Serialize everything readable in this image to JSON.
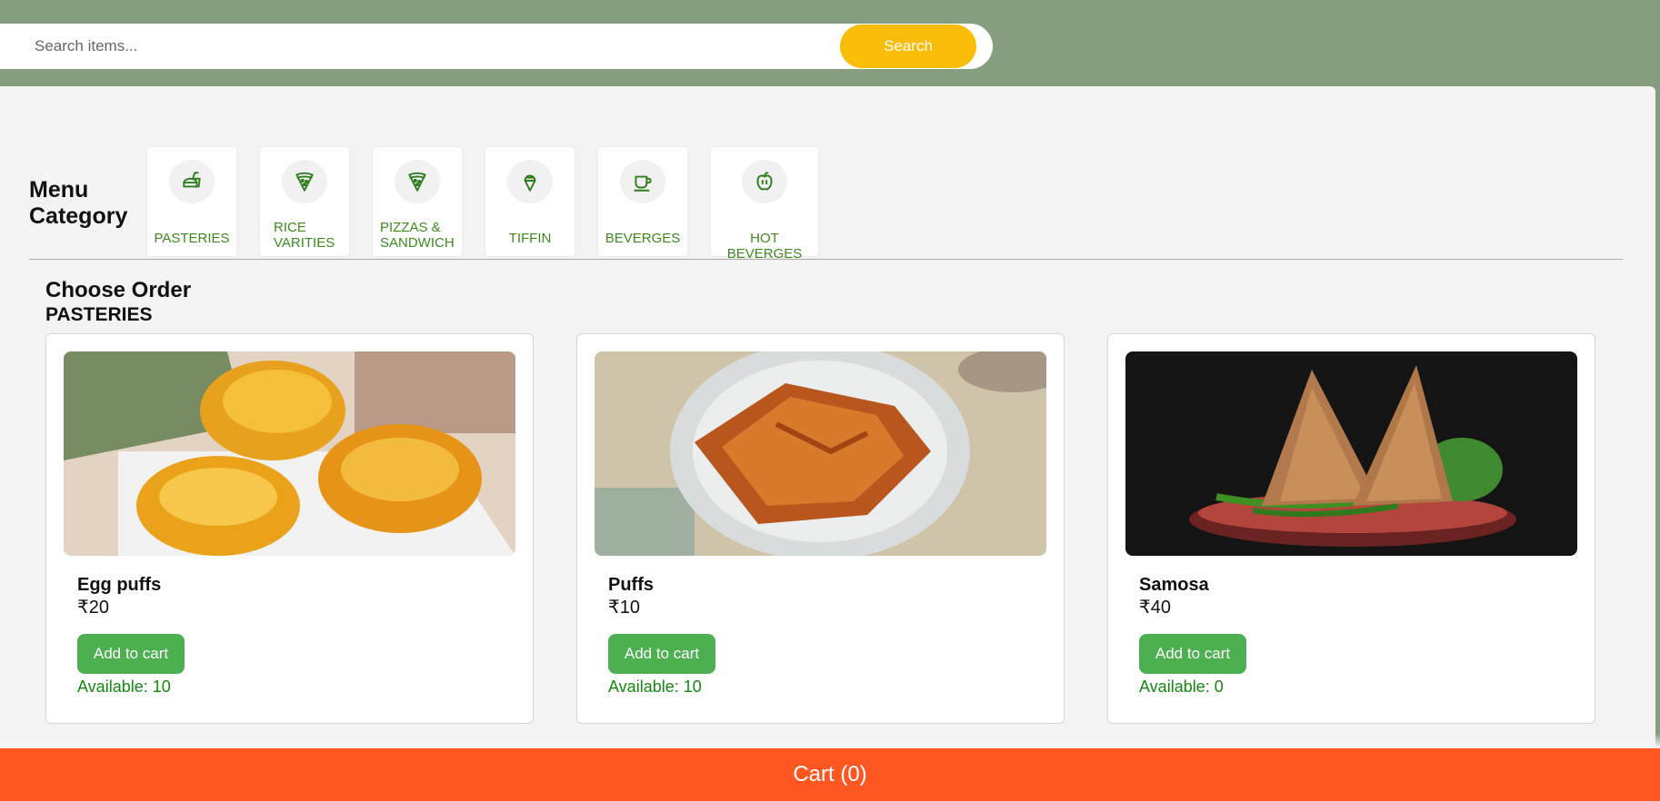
{
  "search": {
    "placeholder": "Search items...",
    "button_label": "Search"
  },
  "menu": {
    "title": "Menu Category",
    "categories": [
      {
        "label": "PASTERIES",
        "icon": "fast-food-icon"
      },
      {
        "label": "RICE VARITIES",
        "icon": "pizza-slice-icon"
      },
      {
        "label": "PIZZAS & SANDWICH",
        "icon": "pizza-slice-icon"
      },
      {
        "label": "TIFFIN",
        "icon": "ice-cream-icon"
      },
      {
        "label": "BEVERGES",
        "icon": "coffee-cup-icon"
      },
      {
        "label": "HOT BEVERGES",
        "icon": "apple-icon"
      }
    ]
  },
  "order": {
    "title": "Choose Order",
    "category": "PASTERIES",
    "products": [
      {
        "name": "Egg puffs",
        "price": "₹20",
        "button": "Add to cart",
        "availability": "Available: 10"
      },
      {
        "name": "Puffs",
        "price": "₹10",
        "button": "Add to cart",
        "availability": "Available: 10"
      },
      {
        "name": "Samosa",
        "price": "₹40",
        "button": "Add to cart",
        "availability": "Available: 0"
      }
    ]
  },
  "cart": {
    "label": "Cart (0)"
  },
  "colors": {
    "header_bg": "#869e7f",
    "search_button": "#fbbc08",
    "add_button": "#4caf50",
    "cart_bar": "#ff5722",
    "category_text": "#3d8a1e"
  }
}
